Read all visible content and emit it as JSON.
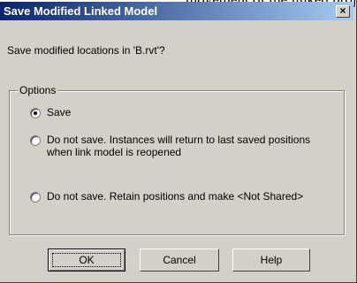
{
  "background": {
    "text": "movement of the linked projectB will pro"
  },
  "window": {
    "title": "Save Modified Linked Model",
    "close_glyph": "×"
  },
  "prompt": "Save modified locations in 'B.rvt'?",
  "options": {
    "legend": "Options",
    "items": [
      {
        "label": "Save",
        "checked": true
      },
      {
        "label": "Do not save. Instances will return to last saved positions",
        "label_line2": "when link model is reopened",
        "checked": false
      },
      {
        "label": "Do not save. Retain positions and make <Not Shared>",
        "checked": false
      }
    ]
  },
  "buttons": {
    "ok": "OK",
    "cancel": "Cancel",
    "help": "Help"
  }
}
